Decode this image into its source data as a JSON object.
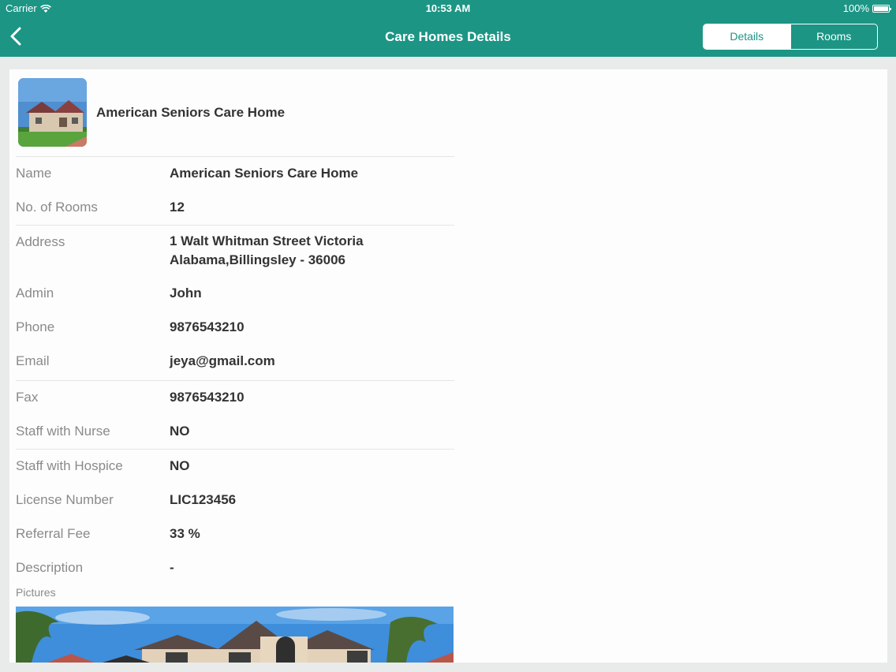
{
  "status": {
    "carrier": "Carrier",
    "time": "10:53 AM",
    "battery": "100%"
  },
  "nav": {
    "title": "Care Homes Details",
    "tabs": [
      "Details",
      "Rooms"
    ],
    "active_tab": "Details"
  },
  "home": {
    "name": "American Seniors Care Home"
  },
  "fields": [
    {
      "label": "Name",
      "value": "American Seniors Care Home"
    },
    {
      "label": "No. of Rooms",
      "value": "12"
    },
    {
      "label": "Address",
      "value": "1 Walt Whitman Street  Victoria",
      "value2": "Alabama,Billingsley - 36006"
    },
    {
      "label": "Admin",
      "value": "John"
    },
    {
      "label": "Phone",
      "value": "9876543210"
    },
    {
      "label": "Email",
      "value": "jeya@gmail.com"
    },
    {
      "label": "Fax",
      "value": "9876543210"
    },
    {
      "label": "Staff with Nurse",
      "value": "NO"
    },
    {
      "label": "Staff with Hospice",
      "value": "NO"
    },
    {
      "label": "License Number",
      "value": "LIC123456"
    },
    {
      "label": "Referral Fee",
      "value": "33 %"
    },
    {
      "label": "Description",
      "value": "-"
    }
  ],
  "pictures_label": "Pictures",
  "colors": {
    "accent": "#1c9585",
    "background": "#e9ebeb"
  },
  "icons": {
    "back": "chevron-left-icon",
    "wifi": "wifi-icon",
    "battery": "battery-icon"
  }
}
